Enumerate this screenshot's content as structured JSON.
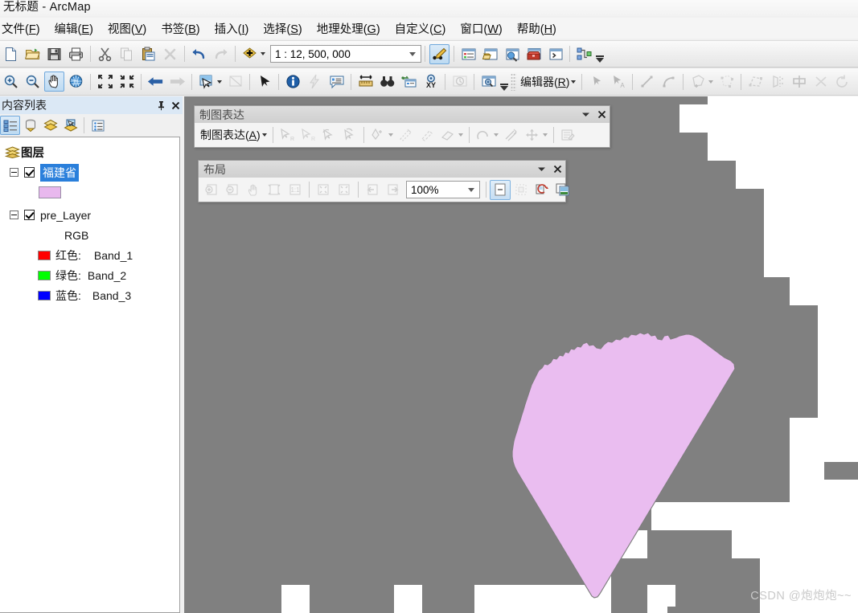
{
  "window": {
    "title": "无标题 - ArcMap"
  },
  "menubar": {
    "items": [
      {
        "name": "menu-file",
        "label": "文件",
        "accel": "F"
      },
      {
        "name": "menu-edit",
        "label": "编辑",
        "accel": "E"
      },
      {
        "name": "menu-view",
        "label": "视图",
        "accel": "V"
      },
      {
        "name": "menu-bookmarks",
        "label": "书签",
        "accel": "B"
      },
      {
        "name": "menu-insert",
        "label": "插入",
        "accel": "I"
      },
      {
        "name": "menu-selection",
        "label": "选择",
        "accel": "S"
      },
      {
        "name": "menu-geoprocessing",
        "label": "地理处理",
        "accel": "G"
      },
      {
        "name": "menu-customize",
        "label": "自定义",
        "accel": "C"
      },
      {
        "name": "menu-window",
        "label": "窗口",
        "accel": "W"
      },
      {
        "name": "menu-help",
        "label": "帮助",
        "accel": "H"
      }
    ]
  },
  "standard_toolbar": {
    "scale": {
      "value": "1 : 12, 500, 000",
      "name": "map-scale-combo"
    },
    "buttons": [
      {
        "name": "new-map-document-button",
        "icon": "new-document-icon",
        "enabled": true
      },
      {
        "name": "open-document-button",
        "icon": "open-folder-icon",
        "enabled": true
      },
      {
        "name": "save-document-button",
        "icon": "save-disk-icon",
        "enabled": true
      },
      {
        "name": "print-button",
        "icon": "printer-icon",
        "enabled": true
      },
      {
        "name": "cut-button",
        "icon": "scissors-icon",
        "enabled": true
      },
      {
        "name": "copy-button",
        "icon": "copy-icon",
        "enabled": false
      },
      {
        "name": "paste-button",
        "icon": "clipboard-paste-icon",
        "enabled": true
      },
      {
        "name": "delete-button",
        "icon": "delete-x-icon",
        "enabled": false
      },
      {
        "name": "undo-button",
        "icon": "undo-arrow-icon",
        "enabled": true
      },
      {
        "name": "redo-button",
        "icon": "redo-arrow-icon",
        "enabled": false
      },
      {
        "name": "add-data-button",
        "icon": "add-data-plus-icon",
        "enabled": true
      },
      {
        "name": "editor-toolbar-toggle-button",
        "icon": "edit-pencil-icon",
        "enabled": true
      },
      {
        "name": "table-of-contents-button",
        "icon": "table-of-contents-icon",
        "enabled": true
      },
      {
        "name": "catalog-window-button",
        "icon": "catalog-window-icon",
        "enabled": true
      },
      {
        "name": "search-window-button",
        "icon": "search-window-icon",
        "enabled": true
      },
      {
        "name": "arctoolbox-button",
        "icon": "toolbox-icon",
        "enabled": true
      },
      {
        "name": "python-window-button",
        "icon": "python-window-icon",
        "enabled": true
      },
      {
        "name": "model-builder-button",
        "icon": "model-builder-icon",
        "enabled": true
      }
    ]
  },
  "tools_toolbar": {
    "buttons": [
      {
        "name": "zoom-in-tool",
        "icon": "magnifier-plus-icon",
        "enabled": true,
        "active": false
      },
      {
        "name": "zoom-out-tool",
        "icon": "magnifier-minus-icon",
        "enabled": true,
        "active": false
      },
      {
        "name": "pan-tool",
        "icon": "hand-pan-icon",
        "enabled": true,
        "active": true
      },
      {
        "name": "full-extent-tool",
        "icon": "globe-icon",
        "enabled": true,
        "active": false
      },
      {
        "name": "fixed-zoom-in-tool",
        "icon": "arrows-in-icon",
        "enabled": true,
        "active": false
      },
      {
        "name": "fixed-zoom-out-tool",
        "icon": "arrows-out-icon",
        "enabled": true,
        "active": false
      },
      {
        "name": "go-back-extent-tool",
        "icon": "arrow-left-icon",
        "enabled": true,
        "active": false
      },
      {
        "name": "go-next-extent-tool",
        "icon": "arrow-right-icon",
        "enabled": false,
        "active": false
      },
      {
        "name": "select-features-tool",
        "icon": "select-features-icon",
        "enabled": true,
        "active": false
      },
      {
        "name": "clear-selection-tool",
        "icon": "clear-selection-icon",
        "enabled": false,
        "active": false
      },
      {
        "name": "select-elements-tool",
        "icon": "arrow-pointer-icon",
        "enabled": true,
        "active": false
      },
      {
        "name": "identify-tool",
        "icon": "info-circle-icon",
        "enabled": true,
        "active": false
      },
      {
        "name": "hyperlink-tool",
        "icon": "lightning-bolt-icon",
        "enabled": false,
        "active": false
      },
      {
        "name": "html-popup-tool",
        "icon": "html-popup-icon",
        "enabled": true,
        "active": false
      },
      {
        "name": "measure-tool",
        "icon": "ruler-measure-icon",
        "enabled": true,
        "active": false
      },
      {
        "name": "find-tool",
        "icon": "binoculars-icon",
        "enabled": true,
        "active": false
      },
      {
        "name": "find-route-tool",
        "icon": "find-route-icon",
        "enabled": true,
        "active": false
      },
      {
        "name": "go-to-xy-tool",
        "icon": "go-to-xy-icon",
        "enabled": true,
        "active": false
      },
      {
        "name": "time-slider-button",
        "icon": "clock-time-icon",
        "enabled": false,
        "active": false
      },
      {
        "name": "create-viewer-window-tool",
        "icon": "viewer-window-icon",
        "enabled": true,
        "active": false
      }
    ],
    "editor": {
      "name": "editor-menu-button",
      "label": "编辑器",
      "accel": "R",
      "buttons": [
        {
          "name": "edit-tool",
          "icon": "black-arrow-icon",
          "enabled": false
        },
        {
          "name": "edit-annotation-tool",
          "icon": "arrow-annotation-icon",
          "enabled": false
        },
        {
          "name": "straight-segment-tool",
          "icon": "straight-segment-icon",
          "enabled": false
        },
        {
          "name": "curve-segment-tool",
          "icon": "curve-segment-icon",
          "enabled": false
        },
        {
          "name": "create-features-tool",
          "icon": "polygon-plus-icon",
          "enabled": false
        },
        {
          "name": "edit-vertices-tool",
          "icon": "edit-vertices-icon",
          "enabled": false
        },
        {
          "name": "reshape-feature-tool",
          "icon": "reshape-feature-icon",
          "enabled": false
        },
        {
          "name": "split-tool",
          "icon": "split-polygon-icon",
          "enabled": false
        },
        {
          "name": "mirror-features-tool",
          "icon": "mirror-features-icon",
          "enabled": false
        },
        {
          "name": "merge-tool",
          "icon": "merge-x-icon",
          "enabled": false
        },
        {
          "name": "rotate-tool",
          "icon": "rotate-icon",
          "enabled": false
        }
      ]
    }
  },
  "toc": {
    "title": "内容列表",
    "pin_icon": "pin-icon",
    "close_icon": "close-icon",
    "toolbar": [
      {
        "name": "list-by-drawing-order-button",
        "icon": "list-drawing-order-icon",
        "active": true
      },
      {
        "name": "list-by-source-button",
        "icon": "list-by-source-icon",
        "active": false
      },
      {
        "name": "list-by-visibility-button",
        "icon": "list-by-visibility-icon",
        "active": false
      },
      {
        "name": "list-by-selection-button",
        "icon": "list-by-selection-icon",
        "active": false
      },
      {
        "name": "toc-options-button",
        "icon": "toc-options-icon",
        "active": false
      }
    ],
    "tree": {
      "root_label": "图层",
      "root_icon": "layers-stack-icon",
      "layers": [
        {
          "name": "layer-fujian",
          "label": "福建省",
          "checked": true,
          "selected": true,
          "symbol_type": "polygon-swatch",
          "symbol_fill": "#e8b8ee",
          "symbol_outline": "#9a8fa6"
        },
        {
          "name": "layer-pre",
          "label": "pre_Layer",
          "checked": true,
          "selected": false,
          "renderer_label": "RGB",
          "bands": [
            {
              "name": "band-red",
              "label": "红色:",
              "band": "Band_1",
              "color": "#ff0000"
            },
            {
              "name": "band-green",
              "label": "绿色:",
              "band": "Band_2",
              "color": "#00ff00"
            },
            {
              "name": "band-blue",
              "label": "蓝色:",
              "band": "Band_3",
              "color": "#0000ff"
            }
          ]
        }
      ]
    }
  },
  "floating_toolbars": [
    {
      "name": "representation-toolbar",
      "title": "制图表达",
      "menu_label": "制图表达",
      "menu_accel": "A",
      "collapse_icon": "chevron-down-icon",
      "close_icon": "close-icon",
      "buttons": [
        {
          "name": "select-representation-tool",
          "icon": "select-representation-icon",
          "enabled": false
        },
        {
          "name": "direct-select-representation-tool",
          "icon": "direct-select-icon",
          "enabled": false
        },
        {
          "name": "rotate-marker-tool",
          "icon": "rotate-marker-icon",
          "enabled": false
        },
        {
          "name": "resize-marker-tool",
          "icon": "resize-marker-icon",
          "enabled": false
        },
        {
          "name": "marker-editor-tool",
          "icon": "marker-editor-icon",
          "enabled": false
        },
        {
          "name": "warp-tool",
          "icon": "warp-icon",
          "enabled": false
        },
        {
          "name": "effects-tool",
          "icon": "effects-icon",
          "enabled": false
        },
        {
          "name": "eraser-tool",
          "icon": "eraser-icon",
          "enabled": false
        },
        {
          "name": "free-form-tool",
          "icon": "free-form-icon",
          "enabled": false
        },
        {
          "name": "move-parallel-tool",
          "icon": "move-parallel-icon",
          "enabled": false
        },
        {
          "name": "move-tool",
          "icon": "move-cross-icon",
          "enabled": false
        },
        {
          "name": "representation-properties-button",
          "icon": "representation-properties-icon",
          "enabled": false
        }
      ]
    },
    {
      "name": "layout-toolbar",
      "title": "布局",
      "collapse_icon": "chevron-down-icon",
      "close_icon": "close-icon",
      "zoom": {
        "name": "layout-zoom-combo",
        "value": "100%"
      },
      "buttons": [
        {
          "name": "layout-zoom-in-tool",
          "icon": "page-zoom-in-icon",
          "enabled": false
        },
        {
          "name": "layout-zoom-out-tool",
          "icon": "page-zoom-out-icon",
          "enabled": false
        },
        {
          "name": "layout-pan-tool",
          "icon": "page-pan-hand-icon",
          "enabled": false
        },
        {
          "name": "zoom-whole-page-button",
          "icon": "zoom-whole-page-icon",
          "enabled": false
        },
        {
          "name": "zoom-100-percent-button",
          "icon": "zoom-one-to-one-icon",
          "enabled": false
        },
        {
          "name": "fixed-zoom-in-page-button",
          "icon": "fixed-zoom-in-page-icon",
          "enabled": false
        },
        {
          "name": "fixed-zoom-out-page-button",
          "icon": "fixed-zoom-out-page-icon",
          "enabled": false
        },
        {
          "name": "go-back-extent-page-button",
          "icon": "page-back-icon",
          "enabled": false
        },
        {
          "name": "go-forward-extent-page-button",
          "icon": "page-forward-icon",
          "enabled": false
        },
        {
          "name": "toggle-draft-mode-button",
          "icon": "draft-mode-icon",
          "enabled": true
        },
        {
          "name": "focus-data-frame-button",
          "icon": "focus-data-frame-icon",
          "enabled": false
        },
        {
          "name": "change-layout-button",
          "icon": "change-layout-icon",
          "enabled": true
        },
        {
          "name": "data-driven-pages-button",
          "icon": "data-driven-pages-icon",
          "enabled": true
        }
      ]
    }
  ],
  "map": {
    "name": "map-data-frame",
    "background_color": "#ffffff",
    "raster_color": "#808080",
    "polygon_fill": "#eabdf0",
    "polygon_outline": "#7d7d7d",
    "watermark": "CSDN @炮炮炮~~"
  }
}
